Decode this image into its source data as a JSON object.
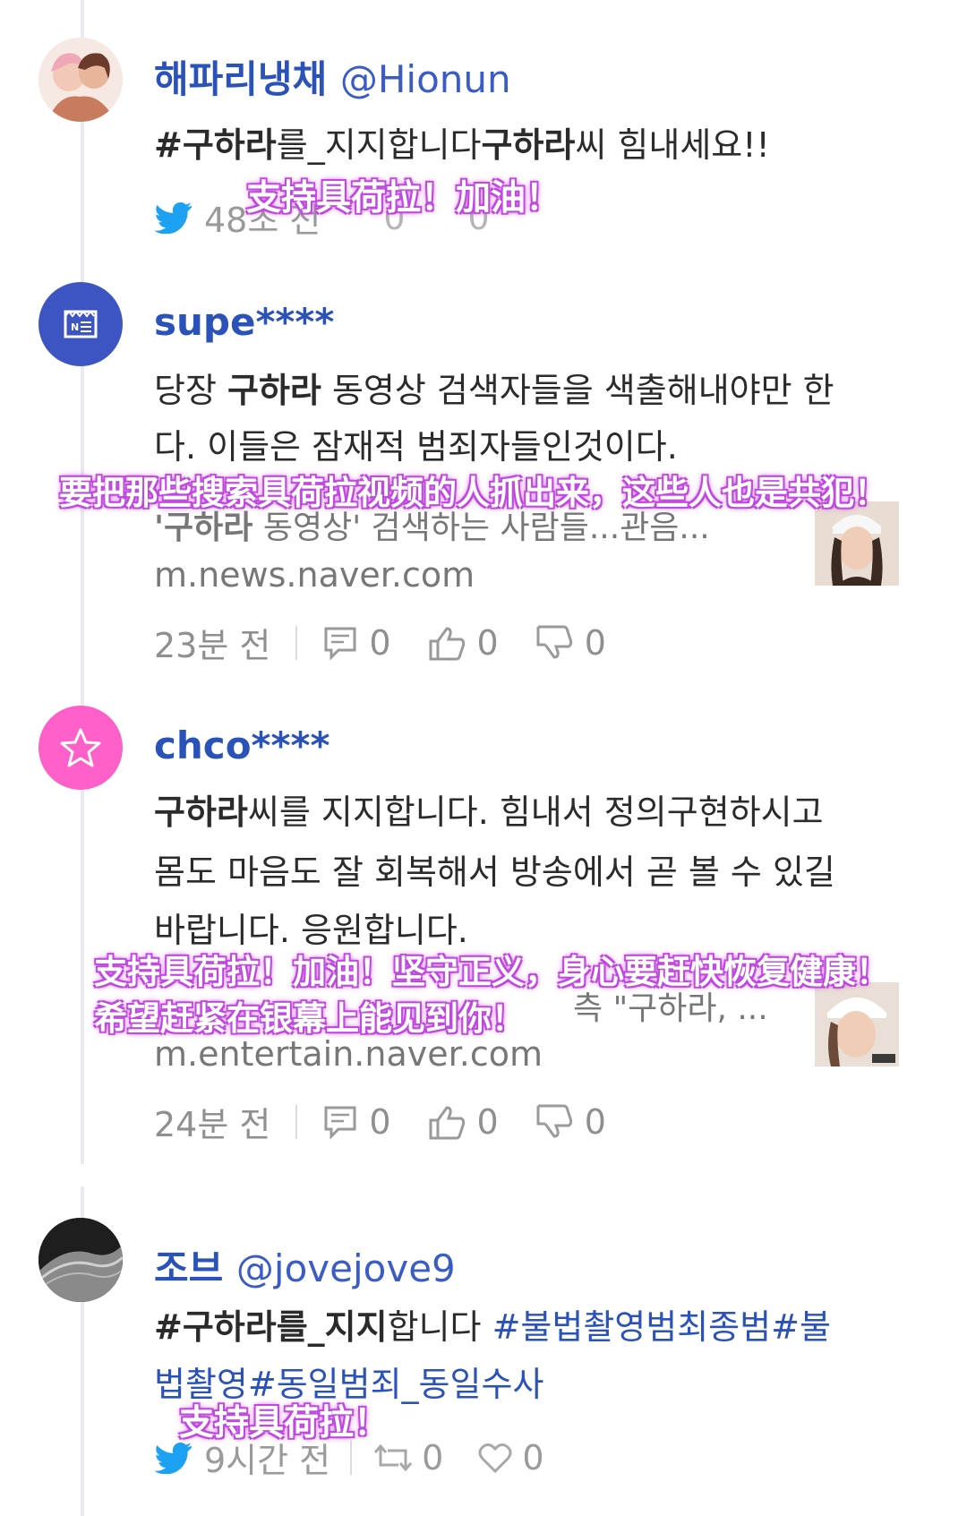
{
  "posts": [
    {
      "username": "해파리냉채",
      "handle": "@Hionun",
      "text_parts": [
        "#",
        "구하라",
        "를_지지합니다",
        "구하라",
        "씨 힘내세요!!"
      ],
      "time": "48초 전",
      "retweets": "0",
      "likes": "0",
      "overlay": "支持具荷拉！加油！"
    },
    {
      "username": "supe****",
      "line1_a": "당장 ",
      "line1_b": "구하라",
      "line1_c": " 동영상 검색자들을 색출해내야만 한",
      "line2": "다. 이들은 잠재적 범죄자들인것이다.",
      "link_title_a": "'구하라",
      "link_title_b": " 동영상' 검색하는 사람들...관음...",
      "link_domain": "m.news.naver.com",
      "time": "23분 전",
      "comments": "0",
      "upvotes": "0",
      "downvotes": "0",
      "overlay": "要把那些搜索具荷拉视频的人抓出来，这些人也是共犯！"
    },
    {
      "username": "chco****",
      "line1_a": "구하라",
      "line1_b": "씨를 지지합니다. 힘내서 정의구현하시고",
      "line2": "몸도 마음도 잘 회복해서 방송에서 곧 볼 수 있길",
      "line3": "바랍니다. 응원합니다.",
      "link_title": "측 \"구하라, ...",
      "link_domain": "m.entertain.naver.com",
      "time": "24분 전",
      "comments": "0",
      "upvotes": "0",
      "downvotes": "0",
      "overlay_line1": "支持具荷拉！加油！坚守正义，身心要赶快恢复健康！",
      "overlay_line2": "希望赶紧在银幕上能见到你！"
    },
    {
      "username": "조브",
      "handle": "@jovejove9",
      "line1_a": "#구하라를_지지",
      "line1_b": "합니다 ",
      "line1_tag": "#불법촬영범최종범#불",
      "line2_tag": "법촬영#동일범죄_동일수사",
      "time": "9시간 전",
      "retweets": "0",
      "likes": "0",
      "overlay": "支持具荷拉！"
    }
  ],
  "colors": {
    "username": "#2a52b8",
    "twitter_blue": "#1da1f2",
    "naver_avatar": "#3d55c2",
    "star_avatar": "#ff5fc8",
    "overlay_glow": "#c04adf"
  }
}
